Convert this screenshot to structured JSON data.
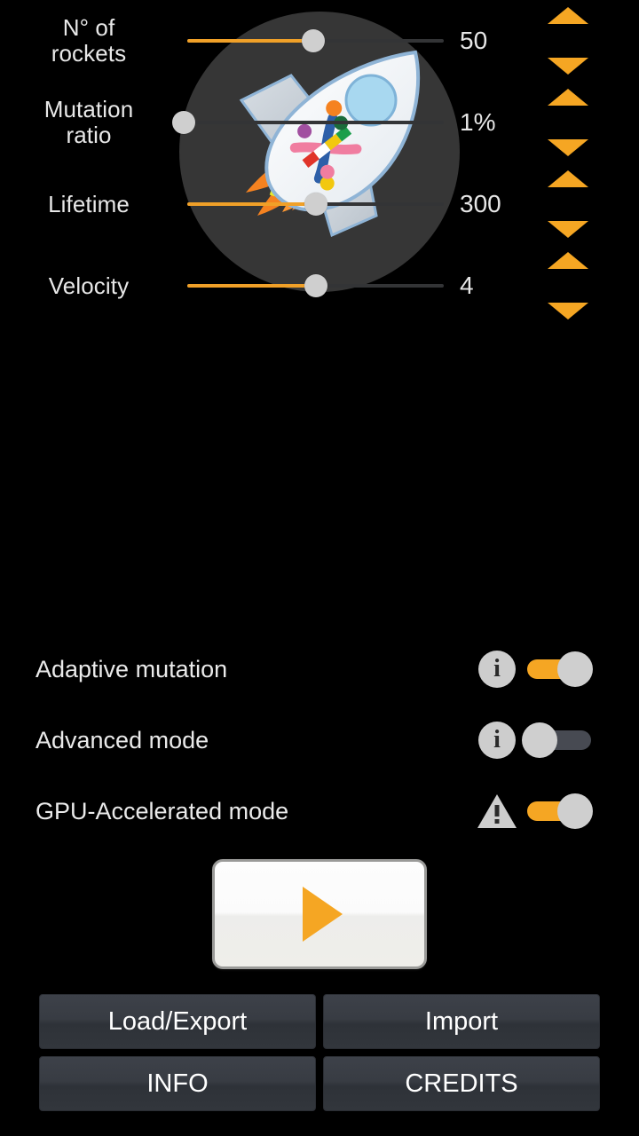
{
  "app": {
    "background_color": "#000000",
    "accent_color": "#f5a623",
    "logo_circle_color": "#363636",
    "logo_icon": "rocket-dna-logo"
  },
  "sliders": [
    {
      "label": "N° of rockets",
      "label_line1": "N° of",
      "label_line2": "rockets",
      "value": "50",
      "fill_percent": 49,
      "thumb_percent": 49,
      "up_icon": "triangle-up-icon",
      "down_icon": "triangle-down-icon"
    },
    {
      "label": "Mutation ratio",
      "label_line1": "Mutation",
      "label_line2": "ratio",
      "value": "1%",
      "fill_percent": 0,
      "thumb_percent": 2,
      "up_icon": "triangle-up-icon",
      "down_icon": "triangle-down-icon"
    },
    {
      "label": "Lifetime",
      "label_line1": "Lifetime",
      "label_line2": "",
      "value": "300",
      "fill_percent": 50,
      "thumb_percent": 50,
      "up_icon": "triangle-up-icon",
      "down_icon": "triangle-down-icon"
    },
    {
      "label": "Velocity",
      "label_line1": "Velocity",
      "label_line2": "",
      "value": "4",
      "fill_percent": 50,
      "thumb_percent": 50,
      "up_icon": "triangle-up-icon",
      "down_icon": "triangle-down-icon"
    }
  ],
  "toggles": [
    {
      "label": "Adaptive mutation",
      "icon": "info-icon",
      "icon_glyph": "i",
      "state": "on"
    },
    {
      "label": "Advanced mode",
      "icon": "info-icon",
      "icon_glyph": "i",
      "state": "off"
    },
    {
      "label": "GPU-Accelerated mode",
      "icon": "warning-icon",
      "icon_glyph": "!",
      "state": "on"
    }
  ],
  "play_button": {
    "icon": "play-icon",
    "label": ""
  },
  "buttons": [
    {
      "label": "Load/Export"
    },
    {
      "label": "Import"
    },
    {
      "label": "INFO"
    },
    {
      "label": "CREDITS"
    }
  ]
}
